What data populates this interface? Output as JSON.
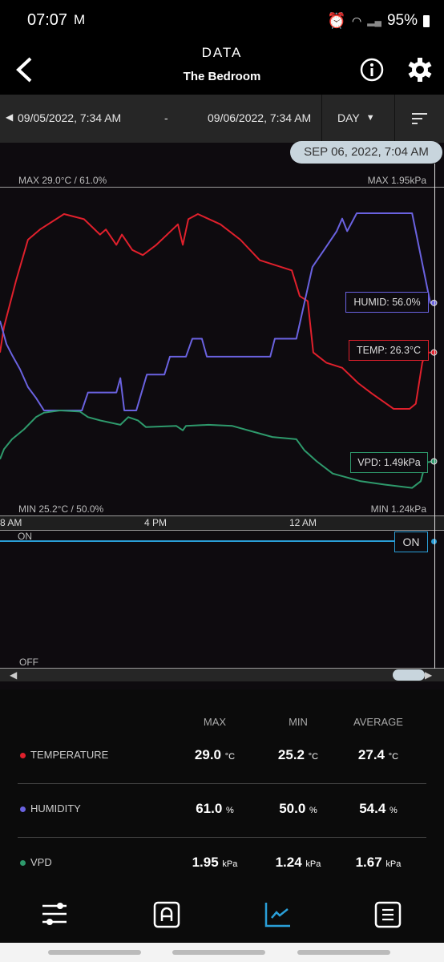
{
  "status_bar": {
    "time": "07:07",
    "battery": "95%",
    "icons": [
      "gmail-icon",
      "alarm-icon",
      "wifi-icon",
      "signal-icon",
      "battery-icon"
    ]
  },
  "header": {
    "title": "DATA",
    "subtitle": "The Bedroom"
  },
  "date_range": {
    "start": "09/05/2022, 7:34 AM",
    "separator": "-",
    "end": "09/06/2022, 7:34 AM",
    "period": "DAY"
  },
  "chart": {
    "cursor_time": "SEP 06, 2022, 7:04 AM",
    "max_left": "MAX 29.0°C / 61.0%",
    "max_right": "MAX 1.95kPa",
    "min_left": "MIN 25.2°C / 50.0%",
    "min_right": "MIN 1.24kPa",
    "x_ticks": [
      "8 AM",
      "4 PM",
      "12 AM"
    ],
    "tags": {
      "humid": "HUMID: 56.0%",
      "temp": "TEMP: 26.3°C",
      "vpd": "VPD: 1.49kPa"
    },
    "switch": {
      "on_label": "ON",
      "off_label": "OFF",
      "current": "ON",
      "color": "#2a9fd8"
    }
  },
  "chart_data": {
    "type": "line",
    "x_range": [
      "09/05 07:34",
      "09/06 07:34"
    ],
    "x_ticks": [
      "8 AM",
      "4 PM",
      "12 AM"
    ],
    "grid": false,
    "series": [
      {
        "key": "temperature",
        "unit": "°C",
        "color": "#e0202c",
        "min": 25.2,
        "max": 29.0,
        "points": [
          [
            "09/05 07:34",
            26.3
          ],
          [
            "09/05 07:47",
            26.8
          ],
          [
            "09/05 08:26",
            27.7
          ],
          [
            "09/05 09:05",
            28.5
          ],
          [
            "09/05 09:44",
            28.7
          ],
          [
            "09/05 11:02",
            29.0
          ],
          [
            "09/05 12:07",
            28.9
          ],
          [
            "09/05 12:59",
            28.6
          ],
          [
            "09/05 13:18",
            28.7
          ],
          [
            "09/05 13:52",
            28.4
          ],
          [
            "09/05 14:10",
            28.6
          ],
          [
            "09/05 14:44",
            28.3
          ],
          [
            "09/05 15:18",
            28.2
          ],
          [
            "09/05 16:02",
            28.4
          ],
          [
            "09/05 17:12",
            28.8
          ],
          [
            "09/05 17:28",
            28.4
          ],
          [
            "09/05 17:46",
            28.9
          ],
          [
            "09/05 18:17",
            29.0
          ],
          [
            "09/05 19:30",
            28.8
          ],
          [
            "09/05 20:35",
            28.5
          ],
          [
            "09/05 21:38",
            28.1
          ],
          [
            "09/05 23:22",
            27.9
          ],
          [
            "09/05 23:48",
            27.4
          ],
          [
            "09/06 00:14",
            27.3
          ],
          [
            "09/06 00:32",
            26.3
          ],
          [
            "09/06 01:14",
            26.1
          ],
          [
            "09/06 02:06",
            26.0
          ],
          [
            "09/06 02:58",
            25.7
          ],
          [
            "09/06 03:42",
            25.5
          ],
          [
            "09/06 04:53",
            25.2
          ],
          [
            "09/06 05:45",
            25.2
          ],
          [
            "09/06 06:05",
            25.3
          ],
          [
            "09/06 06:26",
            26.1
          ],
          [
            "09/06 06:37",
            26.3
          ],
          [
            "09/06 07:04",
            26.3
          ]
        ]
      },
      {
        "key": "humidity",
        "unit": "%",
        "color": "#6a62e0",
        "min": 50.0,
        "max": 61.0,
        "points": [
          [
            "09/05 07:34",
            55.0
          ],
          [
            "09/05 07:55",
            53.7
          ],
          [
            "09/05 08:13",
            53.1
          ],
          [
            "09/05 08:39",
            52.3
          ],
          [
            "09/05 09:05",
            51.3
          ],
          [
            "09/05 09:31",
            50.7
          ],
          [
            "09/05 09:57",
            50.0
          ],
          [
            "09/05 12:00",
            50.0
          ],
          [
            "09/05 12:20",
            51.0
          ],
          [
            "09/05 13:52",
            51.0
          ],
          [
            "09/05 14:05",
            51.8
          ],
          [
            "09/05 14:18",
            50.0
          ],
          [
            "09/05 14:57",
            50.0
          ],
          [
            "09/05 15:31",
            52.0
          ],
          [
            "09/05 16:28",
            52.0
          ],
          [
            "09/05 16:46",
            53.0
          ],
          [
            "09/05 17:38",
            53.0
          ],
          [
            "09/05 17:59",
            54.0
          ],
          [
            "09/05 18:30",
            54.0
          ],
          [
            "09/05 18:46",
            53.0
          ],
          [
            "09/05 22:12",
            53.0
          ],
          [
            "09/05 22:27",
            54.0
          ],
          [
            "09/05 23:37",
            54.0
          ],
          [
            "09/06 00:03",
            56.0
          ],
          [
            "09/06 00:29",
            58.0
          ],
          [
            "09/06 01:09",
            59.0
          ],
          [
            "09/06 01:48",
            60.0
          ],
          [
            "09/06 02:06",
            60.7
          ],
          [
            "09/06 02:22",
            60.0
          ],
          [
            "09/06 02:53",
            61.0
          ],
          [
            "09/06 05:53",
            61.0
          ],
          [
            "09/06 06:52",
            56.0
          ],
          [
            "09/06 07:04",
            56.0
          ]
        ]
      },
      {
        "key": "vpd",
        "unit": "kPa",
        "color": "#2e9a6c",
        "min": 1.24,
        "max": 1.95,
        "points": [
          [
            "09/05 07:34",
            1.51
          ],
          [
            "09/05 07:47",
            1.6
          ],
          [
            "09/05 08:13",
            1.69
          ],
          [
            "09/05 08:52",
            1.78
          ],
          [
            "09/05 09:31",
            1.89
          ],
          [
            "09/05 09:57",
            1.93
          ],
          [
            "09/05 10:49",
            1.95
          ],
          [
            "09/05 11:54",
            1.94
          ],
          [
            "09/05 12:20",
            1.89
          ],
          [
            "09/05 12:59",
            1.86
          ],
          [
            "09/05 14:05",
            1.82
          ],
          [
            "09/05 14:31",
            1.89
          ],
          [
            "09/05 15:02",
            1.86
          ],
          [
            "09/05 15:28",
            1.8
          ],
          [
            "09/05 17:07",
            1.81
          ],
          [
            "09/05 17:28",
            1.77
          ],
          [
            "09/05 17:38",
            1.81
          ],
          [
            "09/05 18:51",
            1.82
          ],
          [
            "09/05 20:09",
            1.81
          ],
          [
            "09/05 21:27",
            1.75
          ],
          [
            "09/05 22:19",
            1.71
          ],
          [
            "09/05 23:37",
            1.69
          ],
          [
            "09/06 00:03",
            1.59
          ],
          [
            "09/06 00:43",
            1.49
          ],
          [
            "09/06 01:35",
            1.38
          ],
          [
            "09/06 03:06",
            1.31
          ],
          [
            "09/06 04:24",
            1.28
          ],
          [
            "09/06 05:53",
            1.25
          ],
          [
            "09/06 06:21",
            1.31
          ],
          [
            "09/06 06:37",
            1.48
          ],
          [
            "09/06 07:04",
            1.49
          ]
        ]
      }
    ]
  },
  "stats": {
    "headers": [
      "MAX",
      "MIN",
      "AVERAGE"
    ],
    "rows": [
      {
        "name": "TEMPERATURE",
        "color": "#e0202c",
        "max": "29.0",
        "min": "25.2",
        "avg": "27.4",
        "unit": "°C"
      },
      {
        "name": "HUMIDITY",
        "color": "#6a62e0",
        "max": "61.0",
        "min": "50.0",
        "avg": "54.4",
        "unit": "%"
      },
      {
        "name": "VPD",
        "color": "#2e9a6c",
        "max": "1.95",
        "min": "1.24",
        "avg": "1.67",
        "unit": "kPa"
      }
    ]
  },
  "nav": {
    "items": [
      "sliders-icon",
      "auto-mode-icon",
      "chart-icon",
      "list-icon"
    ],
    "active": "chart-icon",
    "active_color": "#2a9fd8"
  }
}
